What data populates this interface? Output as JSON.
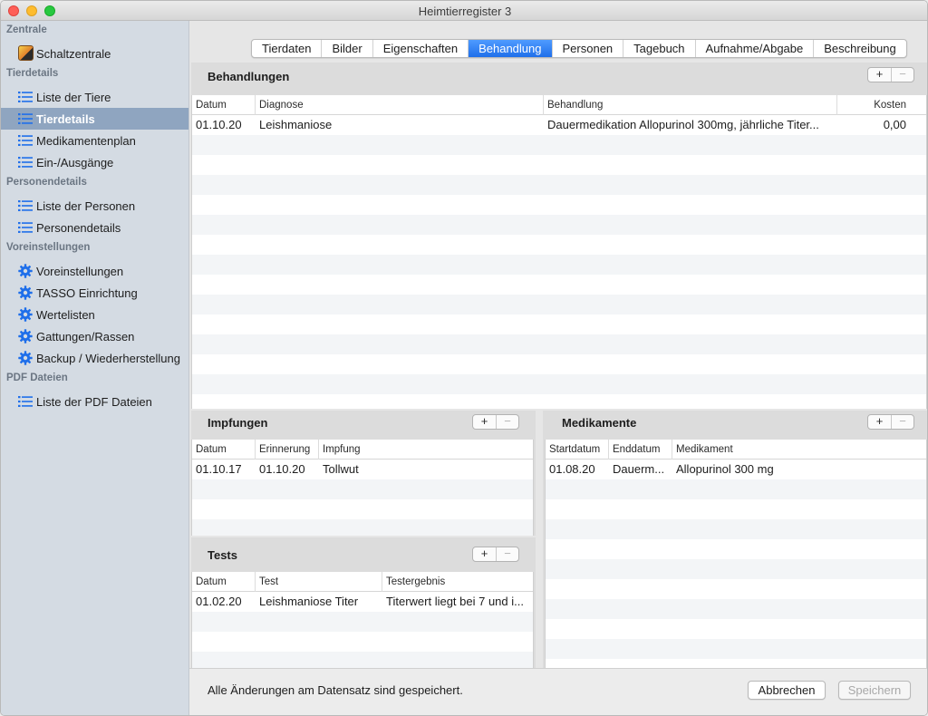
{
  "window": {
    "title": "Heimtierregister 3"
  },
  "sidebar": {
    "sections": [
      {
        "label": "Zentrale"
      },
      {
        "label": "Tierdetails"
      },
      {
        "label": "Personendetails"
      },
      {
        "label": "Voreinstellungen"
      },
      {
        "label": "PDF Dateien"
      }
    ],
    "items": [
      {
        "label": "Schaltzentrale",
        "icon": "app-icon"
      },
      {
        "label": " Liste der Tiere",
        "icon": "list-icon"
      },
      {
        "label": "Tierdetails",
        "icon": "list-icon",
        "selected": true
      },
      {
        "label": "Medikamentenplan",
        "icon": "list-icon"
      },
      {
        "label": "Ein-/Ausgänge",
        "icon": "list-icon"
      },
      {
        "label": "Liste der Personen",
        "icon": "list-icon"
      },
      {
        "label": "Personendetails",
        "icon": "list-icon"
      },
      {
        "label": "Voreinstellungen",
        "icon": "gear-icon"
      },
      {
        "label": "TASSO Einrichtung",
        "icon": "gear-icon"
      },
      {
        "label": "Wertelisten",
        "icon": "gear-icon"
      },
      {
        "label": "Gattungen/Rassen",
        "icon": "gear-icon"
      },
      {
        "label": "Backup / Wiederherstellung",
        "icon": "gear-icon"
      },
      {
        "label": "Liste der PDF Dateien",
        "icon": "list-icon"
      }
    ]
  },
  "tabs": [
    {
      "label": "Tierdaten"
    },
    {
      "label": "Bilder"
    },
    {
      "label": "Eigenschaften"
    },
    {
      "label": "Behandlung",
      "active": true
    },
    {
      "label": "Personen"
    },
    {
      "label": "Tagebuch"
    },
    {
      "label": "Aufnahme/Abgabe"
    },
    {
      "label": "Beschreibung"
    }
  ],
  "buttons": {
    "plus": "+",
    "minus": "−"
  },
  "behandlungen": {
    "title": "Behandlungen",
    "columns": [
      "Datum",
      "Diagnose",
      "Behandlung",
      "Kosten"
    ],
    "rows": [
      [
        "01.10.20",
        "Leishmaniose",
        "Dauermedikation Allopurinol 300mg, jährliche Titer...",
        "0,00"
      ]
    ]
  },
  "impfungen": {
    "title": "Impfungen",
    "columns": [
      "Datum",
      "Erinnerung",
      "Impfung"
    ],
    "rows": [
      [
        "01.10.17",
        "01.10.20",
        "Tollwut"
      ]
    ]
  },
  "tests": {
    "title": "Tests",
    "columns": [
      "Datum",
      "Test",
      "Testergebnis"
    ],
    "rows": [
      [
        "01.02.20",
        "Leishmaniose Titer",
        "Titerwert liegt bei 7 und i..."
      ]
    ]
  },
  "medikamente": {
    "title": "Medikamente",
    "columns": [
      "Startdatum",
      "Enddatum",
      "Medikament"
    ],
    "rows": [
      [
        "01.08.20",
        "Dauerm...",
        "Allopurinol 300 mg"
      ]
    ]
  },
  "status": {
    "text": "Alle Änderungen am Datensatz sind gespeichert.",
    "cancel_label": "Abbrechen",
    "save_label": "Speichern"
  }
}
